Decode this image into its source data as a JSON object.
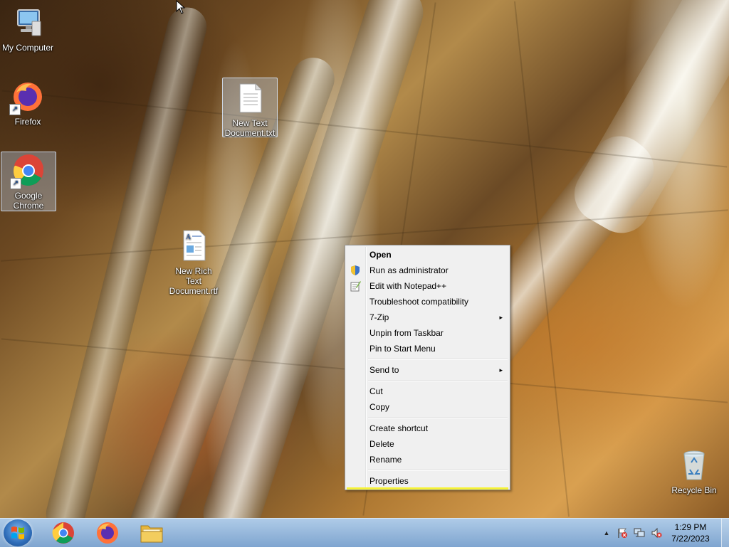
{
  "desktop": {
    "icons": [
      {
        "label": "My Computer",
        "icon": "computer-icon"
      },
      {
        "label": "Firefox",
        "icon": "firefox-icon"
      },
      {
        "label": "Google Chrome",
        "icon": "chrome-icon"
      },
      {
        "label": "New Text Document.txt",
        "icon": "text-document-icon"
      },
      {
        "label": "New Rich Text Document.rtf",
        "icon": "rich-text-document-icon"
      },
      {
        "label": "Recycle Bin",
        "icon": "recycle-bin-icon"
      }
    ]
  },
  "context_menu": {
    "items": [
      {
        "label": "Open",
        "bold": true
      },
      {
        "label": "Run as administrator",
        "icon": "uac-shield-icon"
      },
      {
        "label": "Edit with Notepad++",
        "icon": "notepadpp-icon"
      },
      {
        "label": "Troubleshoot compatibility"
      },
      {
        "label": "7-Zip",
        "submenu": true
      },
      {
        "label": "Unpin from Taskbar"
      },
      {
        "label": "Pin to Start Menu"
      },
      {
        "label": "Send to",
        "submenu": true
      },
      {
        "label": "Cut"
      },
      {
        "label": "Copy"
      },
      {
        "label": "Create shortcut"
      },
      {
        "label": "Delete"
      },
      {
        "label": "Rename"
      },
      {
        "label": "Properties"
      }
    ],
    "submenu_arrow": "▸"
  },
  "taskbar": {
    "start_icon": "windows-logo-icon",
    "pinned": [
      "chrome-icon",
      "firefox-icon",
      "explorer-folder-icon"
    ],
    "tray_icons": [
      "show-hidden-icons-icon",
      "action-center-flag-icon",
      "network-icon",
      "volume-muted-icon"
    ],
    "show_hidden_glyph": "▲",
    "clock_time": "1:29 PM",
    "clock_date": "7/22/2023"
  },
  "colors": {
    "highlight_underline": "#f6f336",
    "menu_bg": "#f0f0f0"
  }
}
